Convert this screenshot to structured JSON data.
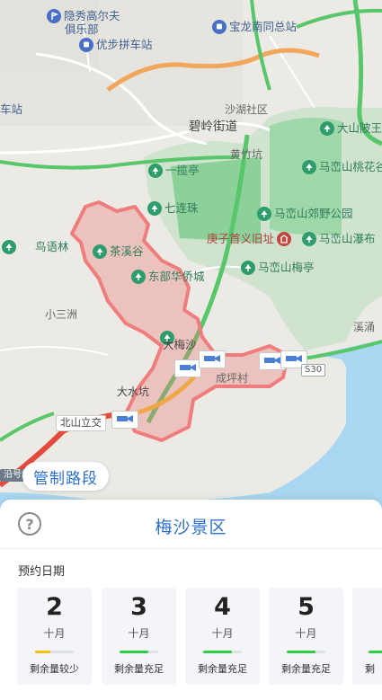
{
  "map": {
    "pois": [
      {
        "id": "yinxiu",
        "label": "隐秀高尔夫",
        "tone": "blue",
        "pin": "golf-icon"
      },
      {
        "id": "yinxiu2",
        "label": "俱乐部",
        "tone": "blue",
        "pin": ""
      },
      {
        "id": "baolong",
        "label": "宝龙南同总站",
        "tone": "blue",
        "pin": "bus-station-icon"
      },
      {
        "id": "youbu",
        "label": "优步拼车站",
        "tone": "blue",
        "pin": "bus-station-icon"
      },
      {
        "id": "station-left",
        "label": "车站",
        "tone": "blue",
        "pin": ""
      },
      {
        "id": "shahu",
        "label": "沙湖社区",
        "tone": "gray",
        "pin": ""
      },
      {
        "id": "biling",
        "label": "碧岭街道",
        "tone": "dark",
        "pin": ""
      },
      {
        "id": "dashan",
        "label": "大山陂王",
        "tone": "green",
        "pin": "tree-icon"
      },
      {
        "id": "huangzhu",
        "label": "黄竹坑",
        "tone": "gray",
        "pin": ""
      },
      {
        "id": "taohua",
        "label": "马峦山桃花谷",
        "tone": "green",
        "pin": "tree-icon"
      },
      {
        "id": "yilan",
        "label": "一揽亭",
        "tone": "green",
        "pin": "tree-icon"
      },
      {
        "id": "qilian",
        "label": "七连珠",
        "tone": "green",
        "pin": "tree-icon"
      },
      {
        "id": "jiaoye",
        "label": "马峦山郊野公园",
        "tone": "green",
        "pin": "tree-icon"
      },
      {
        "id": "niaoyu",
        "label": "鸟语林",
        "tone": "green",
        "pin": "tree-icon"
      },
      {
        "id": "chaxi",
        "label": "茶溪谷",
        "tone": "green",
        "pin": "tree-icon"
      },
      {
        "id": "gengzi",
        "label": "庚子首义旧址",
        "tone": "red",
        "pin": "landmark-icon"
      },
      {
        "id": "pubu",
        "label": "马峦山瀑布",
        "tone": "green",
        "pin": "tree-icon"
      },
      {
        "id": "dongbu",
        "label": "东部华侨城",
        "tone": "green",
        "pin": "tree-icon"
      },
      {
        "id": "meiting",
        "label": "马峦山梅亭",
        "tone": "green",
        "pin": "tree-icon"
      },
      {
        "id": "xiaosan",
        "label": "小三洲",
        "tone": "gray",
        "pin": ""
      },
      {
        "id": "xiyong",
        "label": "溪涌",
        "tone": "gray",
        "pin": ""
      },
      {
        "id": "dameisha",
        "label": "大梅沙",
        "tone": "dark",
        "pin": "tree-icon"
      },
      {
        "id": "chengping",
        "label": "成坪村",
        "tone": "gray",
        "pin": ""
      },
      {
        "id": "dashuikeng",
        "label": "大水坑",
        "tone": "dark",
        "pin": ""
      },
      {
        "id": "beishan",
        "label": "北山立交",
        "tone": "dark",
        "pin": ""
      }
    ],
    "road_shield": "S30",
    "road_shield_left": "沿号线",
    "restricted_label": "管制路段"
  },
  "sheet": {
    "title": "梅沙景区",
    "date_label": "预约日期",
    "dates": [
      {
        "day": "2",
        "month": "十月",
        "status": "剩余量较少",
        "level": 0.4,
        "color": "#f1c40f"
      },
      {
        "day": "3",
        "month": "十月",
        "status": "剩余量充足",
        "level": 0.75,
        "color": "#2ecc40"
      },
      {
        "day": "4",
        "month": "十月",
        "status": "剩余量充足",
        "level": 0.75,
        "color": "#2ecc40"
      },
      {
        "day": "5",
        "month": "十月",
        "status": "剩余量充足",
        "level": 0.75,
        "color": "#2ecc40"
      },
      {
        "day": "",
        "month": "",
        "status": "剩",
        "level": 0.75,
        "color": "#2ecc40"
      }
    ]
  }
}
